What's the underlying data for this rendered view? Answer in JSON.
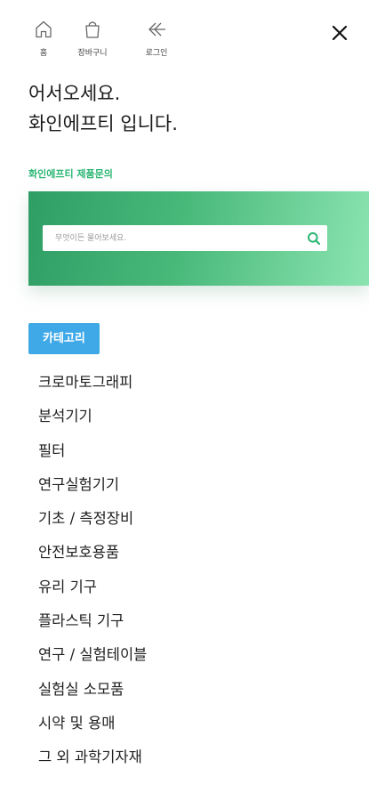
{
  "nav": {
    "home_label": "홈",
    "cart_label": "장바구니",
    "login_label": "로그인"
  },
  "greeting": {
    "line1": "어서오세요.",
    "line2": "화인에프티 입니다."
  },
  "inquiry": {
    "label": "화인에프티 제품문의"
  },
  "search": {
    "placeholder": "무엇이든 물어보세요."
  },
  "category_button": "카테고리",
  "categories": [
    "크로마토그래피",
    "분석기기",
    "필터",
    "연구실험기기",
    "기초 / 측정장비",
    "안전보호용품",
    "유리 기구",
    "플라스틱 기구",
    "연구 / 실험테이블",
    "실험실 소모품",
    "시약 및 용매",
    "그 외 과학기자재"
  ],
  "colors": {
    "accent_green": "#2bb673",
    "category_blue": "#3fa9e8"
  },
  "icons": [
    "home-icon",
    "bag-icon",
    "login-arrow-icon",
    "close-icon",
    "search-icon"
  ]
}
